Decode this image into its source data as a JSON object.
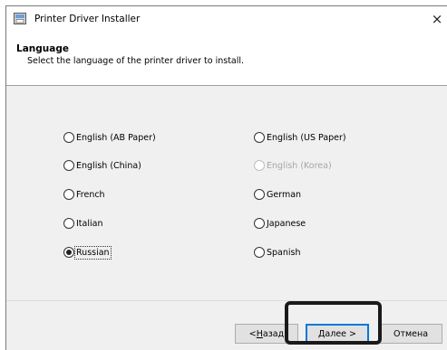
{
  "window": {
    "title": "Printer Driver Installer",
    "close_label": "×"
  },
  "header": {
    "title": "Language",
    "subtitle": "Select the language of the printer driver to install."
  },
  "options": [
    {
      "label": "English (AB Paper)",
      "checked": false,
      "disabled": false
    },
    {
      "label": "English (US Paper)",
      "checked": false,
      "disabled": false
    },
    {
      "label": "English (China)",
      "checked": false,
      "disabled": false
    },
    {
      "label": "English (Korea)",
      "checked": false,
      "disabled": true
    },
    {
      "label": "French",
      "checked": false,
      "disabled": false
    },
    {
      "label": "German",
      "checked": false,
      "disabled": false
    },
    {
      "label": "Italian",
      "checked": false,
      "disabled": false
    },
    {
      "label": "Japanese",
      "checked": false,
      "disabled": false
    },
    {
      "label": "Russian",
      "checked": true,
      "disabled": false
    },
    {
      "label": "Spanish",
      "checked": false,
      "disabled": false
    }
  ],
  "footer": {
    "back": {
      "prefix": "< ",
      "accel": "Н",
      "rest": "азад"
    },
    "next": {
      "accel": "Д",
      "rest": "алее >"
    },
    "cancel": "Отмена"
  },
  "colors": {
    "focus_border": "#0078d7",
    "highlight_frame": "#1a1a1a"
  }
}
